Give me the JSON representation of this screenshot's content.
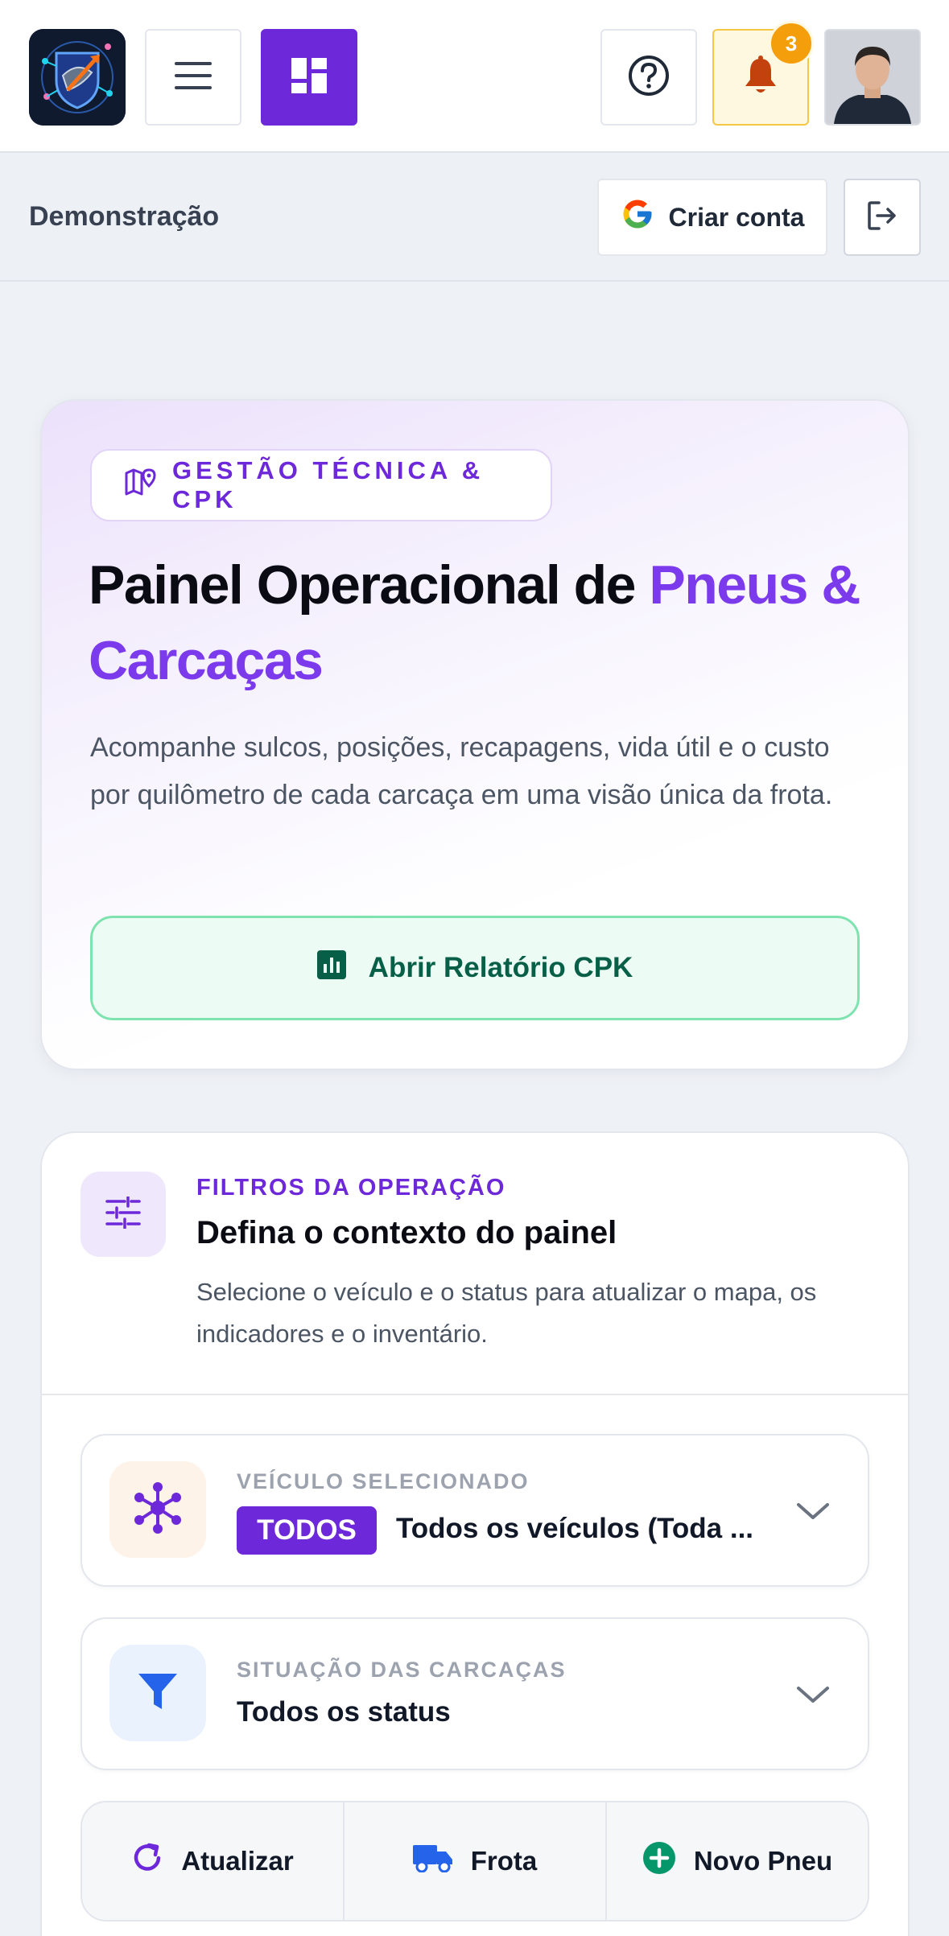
{
  "header": {
    "notifications_count": "3"
  },
  "subheader": {
    "account_label": "Demonstração",
    "create_account_label": "Criar conta"
  },
  "hero": {
    "badge": "GESTÃO TÉCNICA & CPK",
    "title_prefix": "Painel Operacional de ",
    "title_accent": "Pneus & Carcaças",
    "description": "Acompanhe sulcos, posições, recapagens, vida útil e o custo por quilômetro de cada carcaça em uma visão única da frota.",
    "cta_label": "Abrir Relatório CPK"
  },
  "filters": {
    "kicker": "FILTROS DA OPERAÇÃO",
    "title": "Defina o contexto do painel",
    "description": "Selecione o veículo e o status para atualizar o mapa, os indicadores e o inventário.",
    "vehicle": {
      "label": "VEÍCULO SELECIONADO",
      "tag": "TODOS",
      "value": "Todos os veículos (Toda ..."
    },
    "status": {
      "label": "SITUAÇÃO DAS CARCAÇAS",
      "value": "Todos os status"
    },
    "actions": {
      "refresh": "Atualizar",
      "fleet": "Frota",
      "new_tire": "Novo Pneu"
    }
  },
  "colors": {
    "brand": "#6d28d9",
    "accent_green": "#065f46",
    "warning": "#f59e0b",
    "blue": "#2563eb"
  },
  "icons": [
    "app-logo",
    "menu-icon",
    "dashboard-icon",
    "help-icon",
    "bell-icon",
    "google-icon",
    "logout-icon",
    "map-icon",
    "chart-icon",
    "sliders-icon",
    "network-icon",
    "filter-icon",
    "refresh-icon",
    "truck-icon",
    "plus-circle-icon",
    "chevron-down-icon"
  ]
}
